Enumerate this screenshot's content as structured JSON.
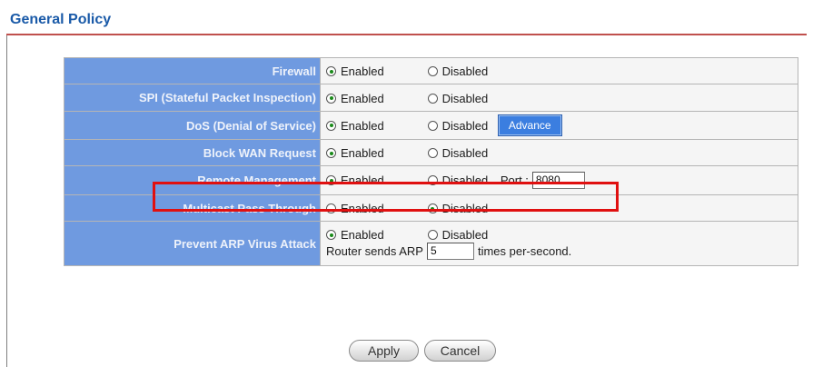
{
  "header": {
    "title": "General Policy"
  },
  "policy_rows": [
    {
      "label": "Firewall",
      "enabled_label": "Enabled",
      "disabled_label": "Disabled",
      "selected": "Enabled"
    },
    {
      "label": "SPI (Stateful Packet Inspection)",
      "enabled_label": "Enabled",
      "disabled_label": "Disabled",
      "selected": "Enabled"
    },
    {
      "label": "DoS (Denial of Service)",
      "enabled_label": "Enabled",
      "disabled_label": "Disabled",
      "selected": "Enabled",
      "button_label": "Advance"
    },
    {
      "label": "Block WAN Request",
      "enabled_label": "Enabled",
      "disabled_label": "Disabled",
      "selected": "Enabled"
    },
    {
      "label": "Remote Management",
      "enabled_label": "Enabled",
      "disabled_label": "Disabled",
      "selected": "Enabled",
      "port_label": "Port :",
      "port_value": "8080"
    },
    {
      "label": "Multicast Pass Through",
      "enabled_label": "Enabled",
      "disabled_label": "Disabled",
      "selected": "Disabled"
    },
    {
      "label": "Prevent ARP Virus Attack",
      "enabled_label": "Enabled",
      "disabled_label": "Disabled",
      "selected": "Enabled",
      "arp_prefix": "Router sends ARP",
      "arp_value": "5",
      "arp_suffix": "times per-second."
    }
  ],
  "buttons": {
    "apply": "Apply",
    "cancel": "Cancel"
  },
  "colors": {
    "title": "#1a5aa8",
    "title_rule": "#c0504d",
    "label_background": "#6f9ae0",
    "value_background": "#f5f5f5",
    "highlight": "#e01010",
    "advance_button": "#3b7ee0"
  }
}
